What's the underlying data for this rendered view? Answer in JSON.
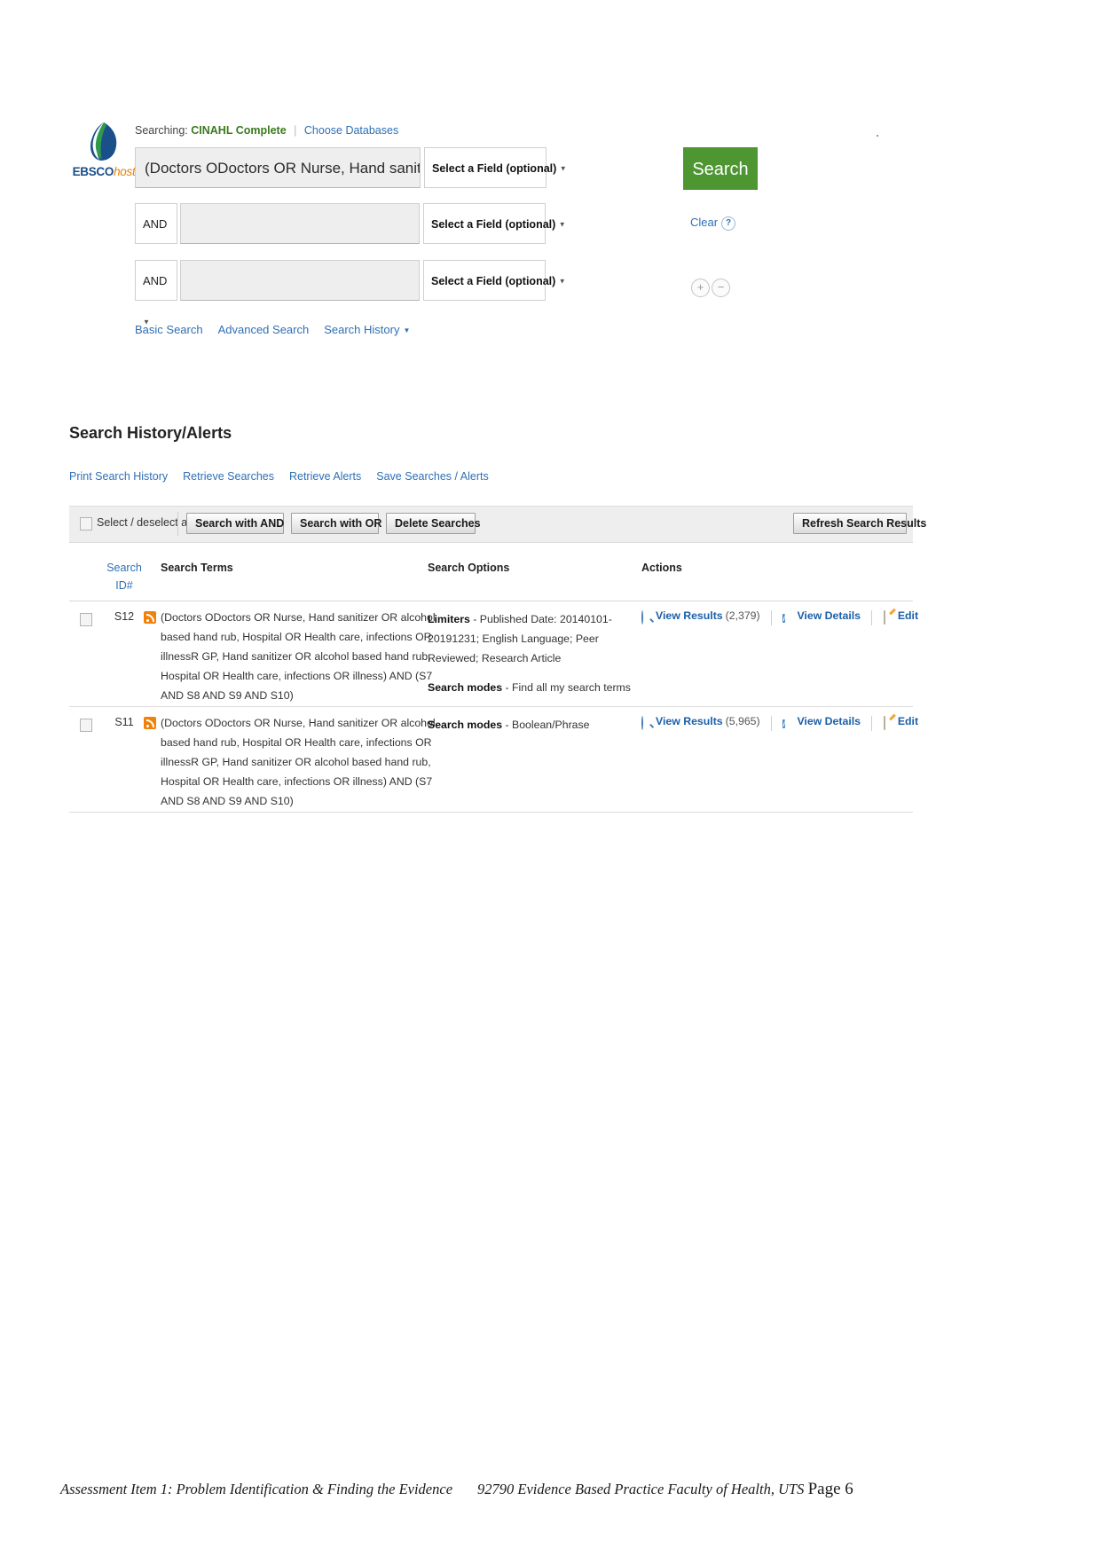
{
  "brand": {
    "name_part1": "EBSCO",
    "name_part2": "host",
    "logo_icon": "ebsco-leaf-logo"
  },
  "search_panel": {
    "searching_label": "Searching:",
    "database": "CINAHL Complete",
    "choose_databases_link": "Choose Databases",
    "search_button": "Search",
    "clear_link": "Clear",
    "help_icon_label": "?",
    "add_row_label": "+",
    "remove_row_label": "−",
    "rows": [
      {
        "query": "(Doctors ODoctors OR Nurse, Hand sanitizer OR a",
        "field_select": "Select a Field (optional)",
        "boolean": null
      },
      {
        "query": "",
        "field_select": "Select a Field (optional)",
        "boolean": "AND"
      },
      {
        "query": "",
        "field_select": "Select a Field (optional)",
        "boolean": "AND"
      }
    ],
    "mode_links": [
      "Basic Search",
      "Advanced Search",
      "Search History"
    ]
  },
  "history": {
    "title": "Search History/Alerts",
    "links": [
      "Print Search History",
      "Retrieve Searches",
      "Retrieve Alerts",
      "Save Searches / Alerts"
    ],
    "toolbar": {
      "select_all_label": "Select / deselect all",
      "search_with_and": "Search with AND",
      "search_with_or": "Search with OR",
      "delete_searches": "Delete Searches",
      "refresh_results": "Refresh Search Results"
    },
    "columns": {
      "id": "Search",
      "id_sub": "ID#",
      "terms": "Search Terms",
      "options": "Search Options",
      "actions": "Actions"
    },
    "rows": [
      {
        "id": "S12",
        "terms": "(Doctors ODoctors OR Nurse, Hand sanitizer OR alcohol based hand rub, Hospital OR Health care, infections OR illnessR GP, Hand sanitizer OR alcohol based hand rub, Hospital OR Health care, infections OR illness) AND (S7 AND S8 AND S9 AND S10)",
        "options_limiters_label": "Limiters",
        "options_limiters_value": " - Published Date: 20140101-20191231; English Language; Peer Reviewed; Research Article",
        "options_modes_label": "Search modes",
        "options_modes_value": " - Find all my search terms",
        "view_results_label": "View Results",
        "view_results_count": "(2,379)",
        "view_details_label": "View Details",
        "edit_label": "Edit"
      },
      {
        "id": "S11",
        "terms": "(Doctors ODoctors OR Nurse, Hand sanitizer OR alcohol based hand rub, Hospital OR Health care, infections OR illnessR GP, Hand sanitizer OR alcohol based hand rub, Hospital OR Health care, infections OR illness) AND (S7 AND S8 AND S9 AND S10)",
        "options_limiters_label": "",
        "options_limiters_value": "",
        "options_modes_label": "Search modes",
        "options_modes_value": " - Boolean/Phrase",
        "view_results_label": "View Results",
        "view_results_count": "(5,965)",
        "view_details_label": "View Details",
        "edit_label": "Edit"
      }
    ]
  },
  "footer": {
    "left": "Assessment Item 1: Problem Identification & Finding the Evidence",
    "right": "92790 Evidence Based Practice Faculty of Health, UTS",
    "page": "Page 6"
  },
  "colors": {
    "search_button_green": "#4e9631",
    "database_green": "#3a7a1f",
    "link_blue": "#2f6fb5",
    "action_blue": "#1b5fa8",
    "rss_orange": "#f0820a",
    "toolbar_gray": "#eeeeee"
  }
}
